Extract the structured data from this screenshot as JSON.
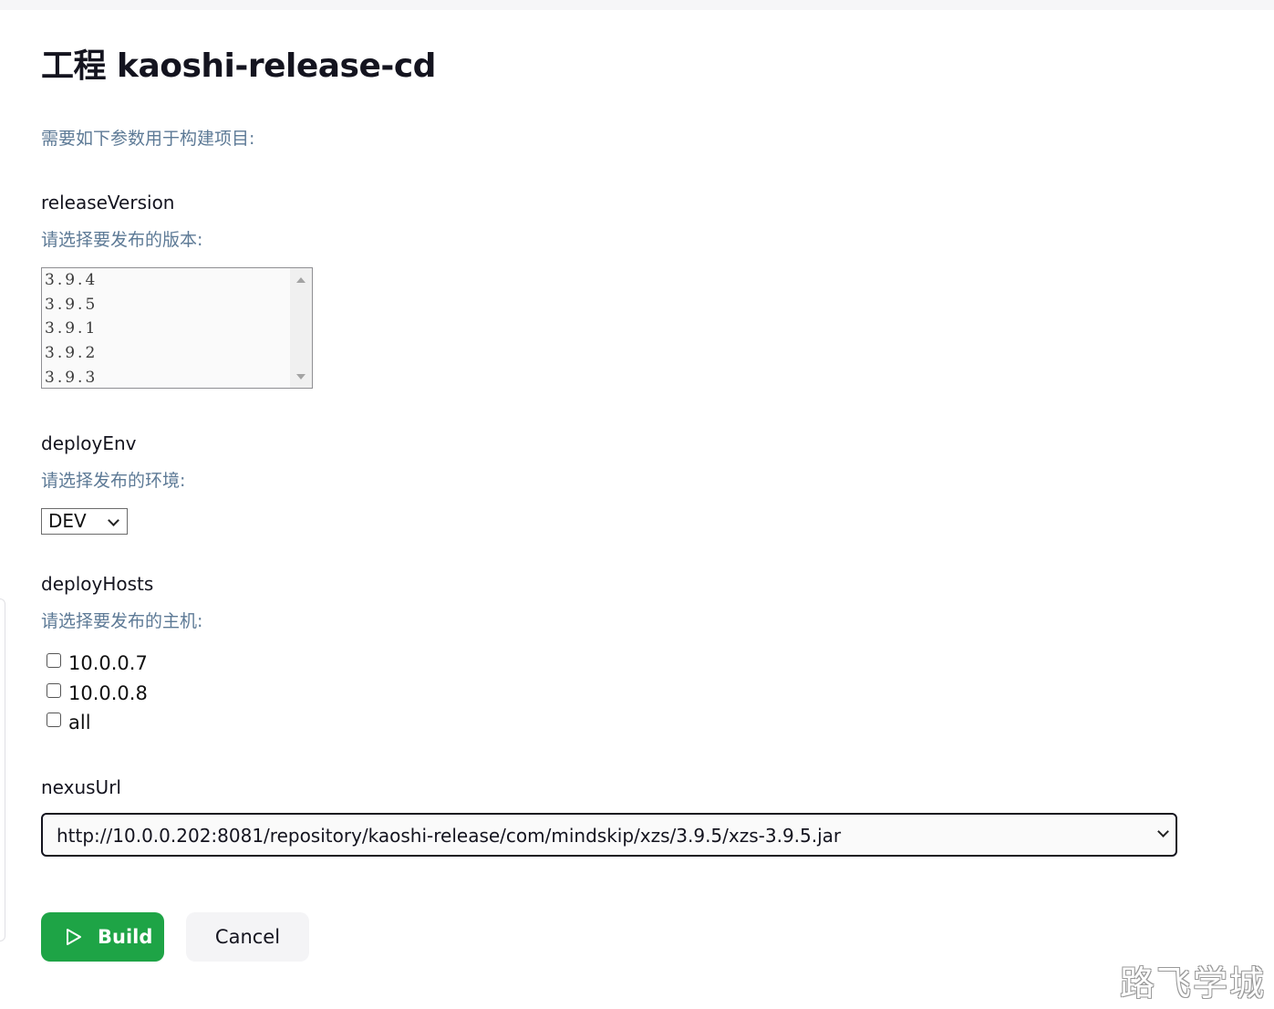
{
  "page": {
    "title": "工程 kaoshi-release-cd",
    "intro": "需要如下参数用于构建项目:"
  },
  "params": {
    "releaseVersion": {
      "name": "releaseVersion",
      "description": "请选择要发布的版本:",
      "options": [
        "3.9.4",
        "3.9.5",
        "3.9.1",
        "3.9.2",
        "3.9.3"
      ]
    },
    "deployEnv": {
      "name": "deployEnv",
      "description": "请选择发布的环境:",
      "selected": "DEV"
    },
    "deployHosts": {
      "name": "deployHosts",
      "description": "请选择要发布的主机:",
      "options": [
        {
          "label": "10.0.0.7",
          "checked": false
        },
        {
          "label": "10.0.0.8",
          "checked": false
        },
        {
          "label": "all",
          "checked": false
        }
      ]
    },
    "nexusUrl": {
      "name": "nexusUrl",
      "selected": "http://10.0.0.202:8081/repository/kaoshi-release/com/mindskip/xzs/3.9.5/xzs-3.9.5.jar"
    }
  },
  "actions": {
    "build_label": "Build",
    "cancel_label": "Cancel",
    "build_icon": "play-icon"
  },
  "watermark": "路飞学城",
  "colors": {
    "build_button": "#1ea446",
    "description_text": "#5d7a96",
    "cancel_button": "#f4f4f6"
  }
}
